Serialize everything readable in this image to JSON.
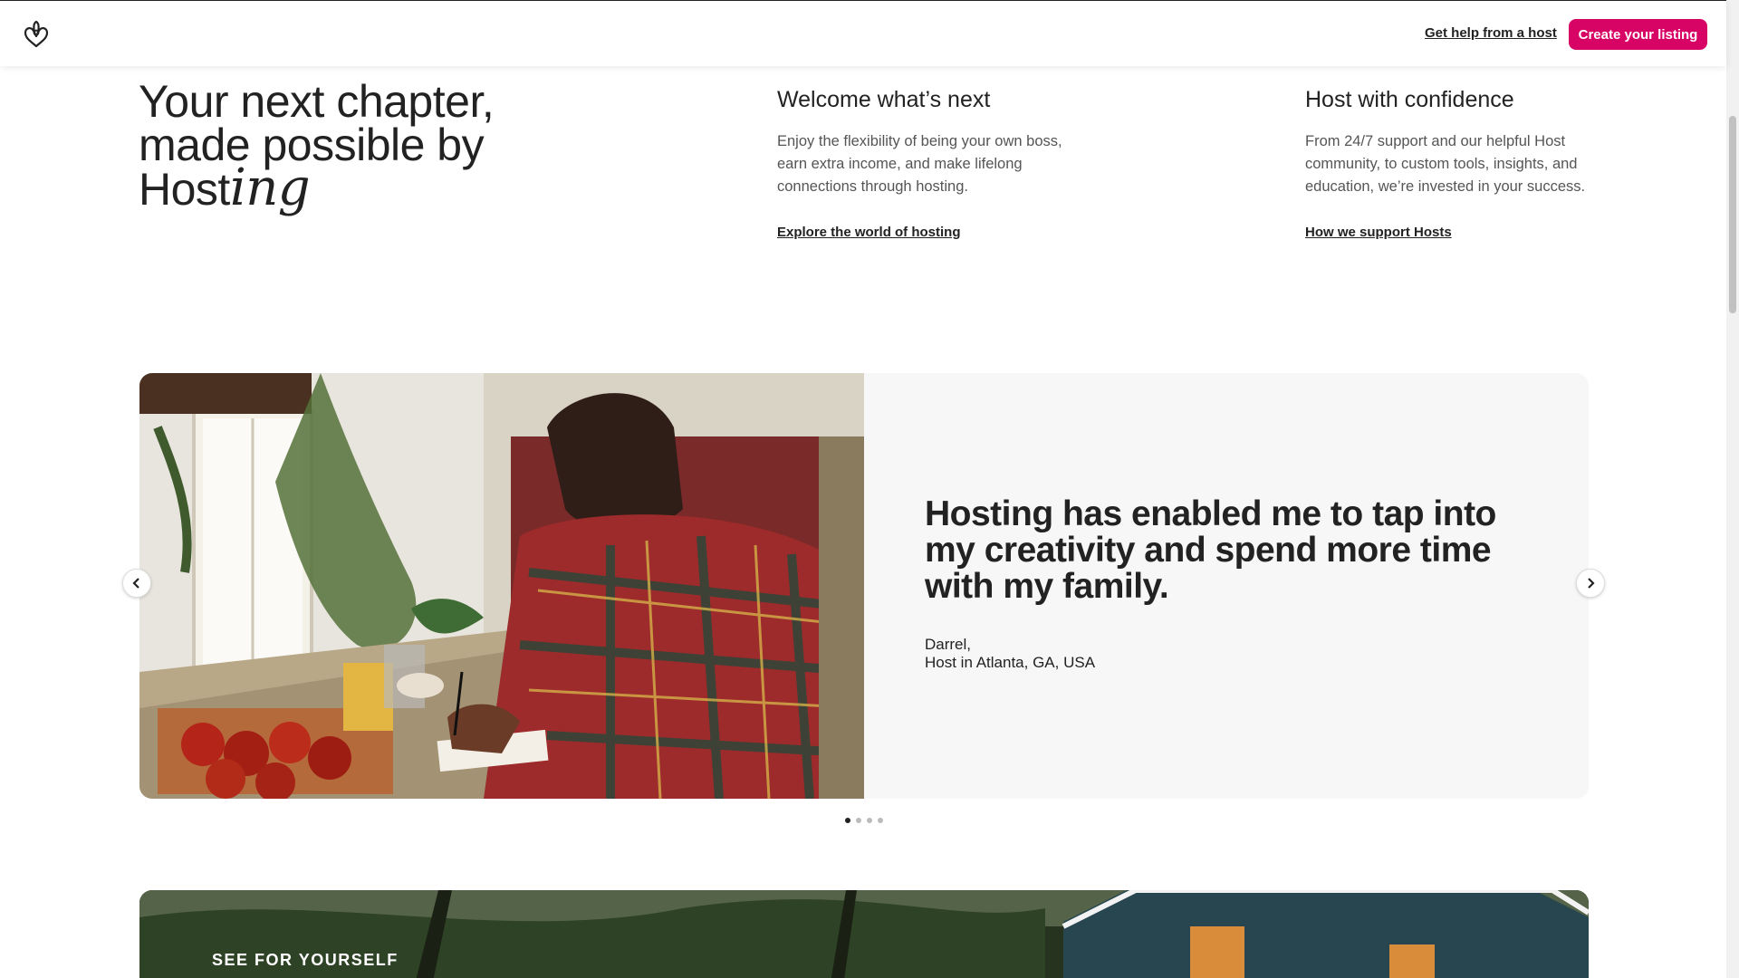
{
  "header": {
    "logo_icon": "airbnb-belo-icon",
    "help_link": "Get help from a host",
    "create_button": "Create your listing",
    "accent_color": "#d70466"
  },
  "hero": {
    "title_line1": "Your next chapter,",
    "title_line2": "made possible by",
    "title_word": "Host",
    "title_script": "ing"
  },
  "columns": [
    {
      "title": "Welcome what’s next",
      "body": "Enjoy the flexibility of being your own boss, earn extra income, and make lifelong connections through hosting.",
      "link": "Explore the world of hosting"
    },
    {
      "title": "Host with confidence",
      "body": "From 24/7 support and our helpful Host community, to custom tools, insights, and education, we’re invested in your success.",
      "link": "How we support Hosts"
    }
  ],
  "testimonial": {
    "quote": "Hosting has enabled me to tap into my creativity and spend more time with my family.",
    "name": "Darrel,",
    "location": "Host in Atlanta, GA, USA",
    "prev_icon": "chevron-left-icon",
    "next_icon": "chevron-right-icon",
    "slide_count": 4,
    "active_slide": 1
  },
  "see_section": {
    "label": "SEE FOR YOURSELF"
  }
}
